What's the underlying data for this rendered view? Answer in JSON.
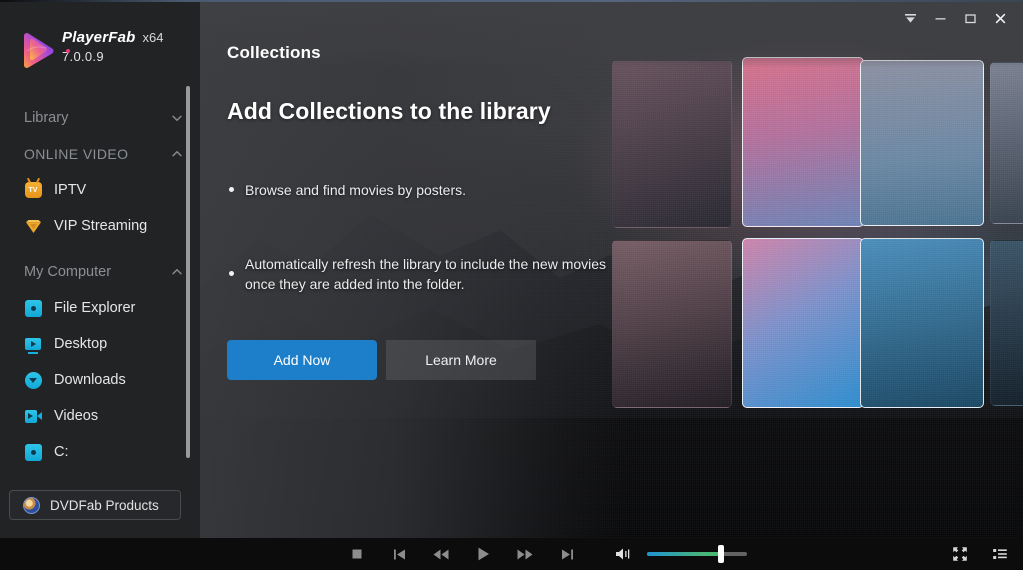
{
  "app": {
    "brand_name": "PlayerFab",
    "architecture": "x64",
    "version": "7.0.0.9"
  },
  "titlebar": {
    "menu_label": "▼",
    "minimize_label": "–",
    "maximize_label": "□",
    "close_label": "✕",
    "icons": [
      "collapse-arrow-icon",
      "minimize-icon",
      "maximize-icon",
      "close-icon"
    ]
  },
  "sidebar": {
    "groups": [
      {
        "label": "Library",
        "state": "collapsed",
        "chevron": "chevron-down-icon"
      },
      {
        "label": "ONLINE VIDEO",
        "state": "expanded",
        "chevron": "chevron-up-icon"
      },
      {
        "label": "My Computer",
        "state": "expanded",
        "chevron": "chevron-up-icon"
      }
    ],
    "online_video_items": [
      {
        "label": "IPTV",
        "icon": "iptv-tv-icon"
      },
      {
        "label": "VIP Streaming",
        "icon": "vip-gem-icon"
      }
    ],
    "my_computer_items": [
      {
        "label": "File Explorer",
        "icon": "folder-disk-icon"
      },
      {
        "label": "Desktop",
        "icon": "monitor-play-icon"
      },
      {
        "label": "Downloads",
        "icon": "download-arrow-icon"
      },
      {
        "label": "Videos",
        "icon": "video-camera-icon"
      },
      {
        "label": "C:",
        "icon": "drive-disk-icon"
      }
    ],
    "products_button": {
      "label": "DVDFab Products",
      "icon": "dvdfab-avatar-icon"
    }
  },
  "main": {
    "page_title": "Collections",
    "hero_heading": "Add Collections to the library",
    "bullets": [
      "Browse and find movies by posters.",
      "Automatically refresh the library to include the new movies once they are added into the folder."
    ],
    "primary_button": "Add Now",
    "secondary_button": "Learn More"
  },
  "player": {
    "controls": [
      {
        "name": "stop-button",
        "icon": "stop-icon"
      },
      {
        "name": "previous-button",
        "icon": "skip-previous-icon"
      },
      {
        "name": "rewind-button",
        "icon": "rewind-icon"
      },
      {
        "name": "play-button",
        "icon": "play-icon"
      },
      {
        "name": "fast-forward-button",
        "icon": "fast-forward-icon"
      },
      {
        "name": "next-button",
        "icon": "skip-next-icon"
      }
    ],
    "volume_icon": "volume-icon",
    "volume_percent": 75,
    "right_controls": [
      {
        "name": "fullscreen-button",
        "icon": "fullscreen-icon"
      },
      {
        "name": "playlist-button",
        "icon": "playlist-icon"
      }
    ]
  },
  "colors": {
    "accent_blue": "#1d7fc9",
    "sidebar_bg": "#222325",
    "main_bg": "#3b3c3f",
    "bottom_bar_bg": "#0c0c0d",
    "iptv_orange": "#e8941c",
    "cyan_icon": "#16b0dc",
    "volume_gradient_start": "#1f93d1",
    "volume_gradient_end": "#4cba6e"
  },
  "posters": [
    {
      "id": 1,
      "row": 1,
      "col": 1,
      "highlighted": false,
      "gradient_from": "#6b5560",
      "gradient_to": "#2b2a33"
    },
    {
      "id": 2,
      "row": 1,
      "col": 2,
      "highlighted": true,
      "gradient_from": "#d4738f",
      "gradient_to": "#6f86b8"
    },
    {
      "id": 3,
      "row": 1,
      "col": 3,
      "highlighted": true,
      "gradient_from": "#8b8fa2",
      "gradient_to": "#5d7f9e"
    },
    {
      "id": 4,
      "row": 1,
      "col": 4,
      "highlighted": false,
      "gradient_from": "#7d8394",
      "gradient_to": "#3a4450"
    },
    {
      "id": 5,
      "row": 2,
      "col": 1,
      "highlighted": false,
      "gradient_from": "#7a6068",
      "gradient_to": "#241f26"
    },
    {
      "id": 6,
      "row": 2,
      "col": 2,
      "highlighted": true,
      "gradient_from": "#cf86ad",
      "gradient_to": "#2f8fd0"
    },
    {
      "id": 7,
      "row": 2,
      "col": 3,
      "highlighted": true,
      "gradient_from": "#4d90bd",
      "gradient_to": "#1d4a66"
    },
    {
      "id": 8,
      "row": 2,
      "col": 4,
      "highlighted": false,
      "gradient_from": "#3d566a",
      "gradient_to": "#16222c"
    }
  ]
}
